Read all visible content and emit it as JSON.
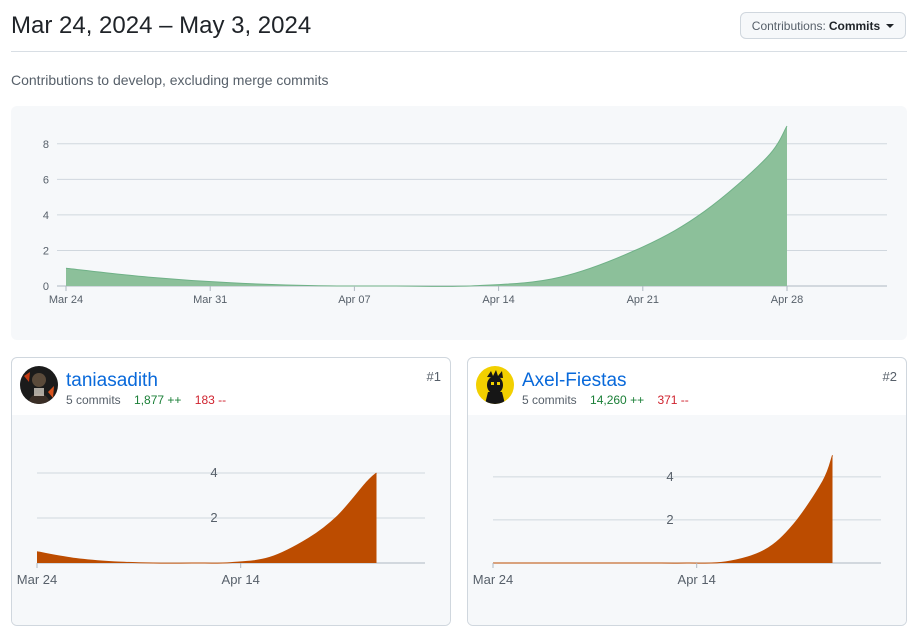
{
  "header": {
    "date_range": "Mar 24, 2024 – May 3, 2024",
    "metric_button": {
      "prefix": "Contributions:",
      "value": "Commits"
    }
  },
  "subtitle": "Contributions to develop, excluding merge commits",
  "colors": {
    "overall_fill": "#8cc09a",
    "overall_stroke": "#6fb187",
    "contributor_fill": "#bc4c00",
    "grid": "#d0d7de",
    "link": "#0969da",
    "additions": "#1a7f37",
    "deletions": "#cf222e"
  },
  "chart_data": [
    {
      "type": "area",
      "x": [
        "2024-03-24",
        "2024-03-28",
        "2024-04-01",
        "2024-04-05",
        "2024-04-09",
        "2024-04-13",
        "2024-04-17",
        "2024-04-21",
        "2024-04-24",
        "2024-04-27",
        "2024-04-28"
      ],
      "values": [
        1.0,
        0.5,
        0.18,
        0.02,
        0,
        0.02,
        0.5,
        2.2,
        4.2,
        7.2,
        9.0
      ],
      "ylim": [
        0,
        9
      ],
      "y_ticks": [
        "0",
        "2",
        "4",
        "6",
        "8"
      ],
      "x_ticks": [
        "Mar 24",
        "Mar 31",
        "Apr 07",
        "Apr 14",
        "Apr 21",
        "Apr 28"
      ],
      "grid": true,
      "title": "",
      "xlabel": "",
      "ylabel": ""
    },
    {
      "type": "area",
      "x": [
        "2024-03-24",
        "2024-03-28",
        "2024-04-01",
        "2024-04-05",
        "2024-04-09",
        "2024-04-13",
        "2024-04-17",
        "2024-04-21",
        "2024-04-24",
        "2024-04-27",
        "2024-04-28"
      ],
      "values": [
        0.5,
        0.2,
        0.05,
        0,
        0,
        0.02,
        0.25,
        1.1,
        2.1,
        3.6,
        4.0
      ],
      "ylim": [
        0,
        4.8
      ],
      "y_ticks": [
        "2",
        "4"
      ],
      "x_ticks": [
        "Mar 24",
        "Apr 14"
      ],
      "grid": true
    },
    {
      "type": "area",
      "x": [
        "2024-03-24",
        "2024-03-28",
        "2024-04-01",
        "2024-04-05",
        "2024-04-09",
        "2024-04-13",
        "2024-04-17",
        "2024-04-21",
        "2024-04-24",
        "2024-04-27",
        "2024-04-28"
      ],
      "values": [
        0,
        0,
        0,
        0,
        0,
        0,
        0.05,
        0.6,
        1.8,
        3.8,
        5.0
      ],
      "ylim": [
        0,
        5.2
      ],
      "y_ticks": [
        "2",
        "4"
      ],
      "x_ticks": [
        "Mar 24",
        "Apr 14"
      ],
      "grid": true
    }
  ],
  "contributors": [
    {
      "username": "taniasadith",
      "commits": "5 commits",
      "additions": "1,877 ++",
      "deletions": "183 --",
      "rank": "#1",
      "avatar": "avatar-dark-image"
    },
    {
      "username": "Axel-Fiestas",
      "commits": "5 commits",
      "additions": "14,260 ++",
      "deletions": "371 --",
      "rank": "#2",
      "avatar": "avatar-yellow-illustration"
    }
  ]
}
